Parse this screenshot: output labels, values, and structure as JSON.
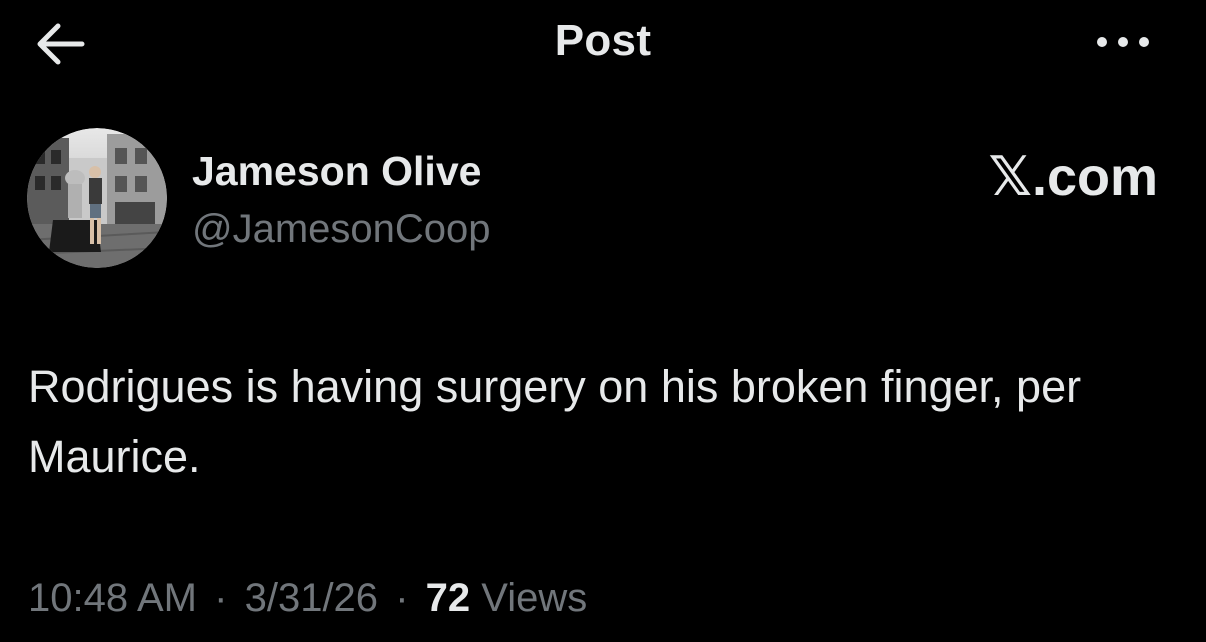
{
  "header": {
    "title": "Post",
    "back_icon": "arrow-left-icon",
    "more_icon": "more-horizontal-icon"
  },
  "author": {
    "display_name": "Jameson Olive",
    "handle": "@JamesonCoop",
    "avatar": "profile-photo"
  },
  "watermark": "𝕏.com",
  "post": {
    "text": "Rodrigues is having surgery on his broken finger, per Maurice."
  },
  "meta": {
    "time": "10:48 AM",
    "separator": "·",
    "date": "3/31/26",
    "views_count": "72",
    "views_label": "Views"
  },
  "colors": {
    "background": "#000000",
    "text_primary": "#e7e9ea",
    "text_secondary": "#71767b"
  }
}
